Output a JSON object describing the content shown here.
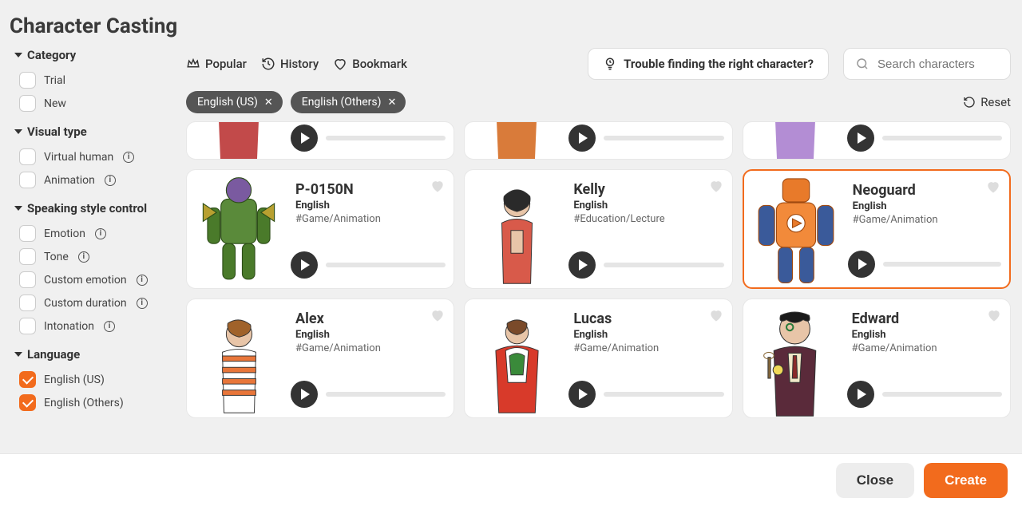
{
  "page_title": "Character Casting",
  "sidebar": {
    "sections": [
      {
        "heading": "Category",
        "items": [
          {
            "label": "Trial",
            "checked": false,
            "info": false
          },
          {
            "label": "New",
            "checked": false,
            "info": false
          }
        ]
      },
      {
        "heading": "Visual type",
        "items": [
          {
            "label": "Virtual human",
            "checked": false,
            "info": true
          },
          {
            "label": "Animation",
            "checked": false,
            "info": true
          }
        ]
      },
      {
        "heading": "Speaking style control",
        "items": [
          {
            "label": "Emotion",
            "checked": false,
            "info": true
          },
          {
            "label": "Tone",
            "checked": false,
            "info": true
          },
          {
            "label": "Custom emotion",
            "checked": false,
            "info": true
          },
          {
            "label": "Custom duration",
            "checked": false,
            "info": true
          },
          {
            "label": "Intonation",
            "checked": false,
            "info": true
          }
        ]
      },
      {
        "heading": "Language",
        "items": [
          {
            "label": "English (US)",
            "checked": true,
            "info": false
          },
          {
            "label": "English (Others)",
            "checked": true,
            "info": false
          }
        ]
      }
    ]
  },
  "topbar": {
    "tabs": [
      {
        "icon": "crown-icon",
        "label": "Popular"
      },
      {
        "icon": "history-icon",
        "label": "History"
      },
      {
        "icon": "heart-outline-icon",
        "label": "Bookmark"
      }
    ],
    "help_label": "Trouble finding the right character?",
    "search_placeholder": "Search characters"
  },
  "chips": [
    {
      "label": "English (US)"
    },
    {
      "label": "English (Others)"
    }
  ],
  "reset_label": "Reset",
  "characters_partial": [
    {
      "color": "#c24a4a"
    },
    {
      "color": "#d97b3a"
    },
    {
      "color": "#b38dd4"
    }
  ],
  "characters": [
    {
      "name": "P-0150N",
      "lang": "English",
      "tag": "#Game/Animation",
      "selected": false,
      "svg": "robot-green"
    },
    {
      "name": "Kelly",
      "lang": "English",
      "tag": "#Education/Lecture",
      "selected": false,
      "svg": "woman-red"
    },
    {
      "name": "Neoguard",
      "lang": "English",
      "tag": "#Game/Animation",
      "selected": true,
      "svg": "robot-orange"
    },
    {
      "name": "Alex",
      "lang": "English",
      "tag": "#Game/Animation",
      "selected": false,
      "svg": "boy-stripes"
    },
    {
      "name": "Lucas",
      "lang": "English",
      "tag": "#Game/Animation",
      "selected": false,
      "svg": "boy-hoodie"
    },
    {
      "name": "Edward",
      "lang": "English",
      "tag": "#Game/Animation",
      "selected": false,
      "svg": "gentleman"
    }
  ],
  "footer": {
    "close": "Close",
    "create": "Create"
  },
  "colors": {
    "accent": "#f26b1d"
  }
}
